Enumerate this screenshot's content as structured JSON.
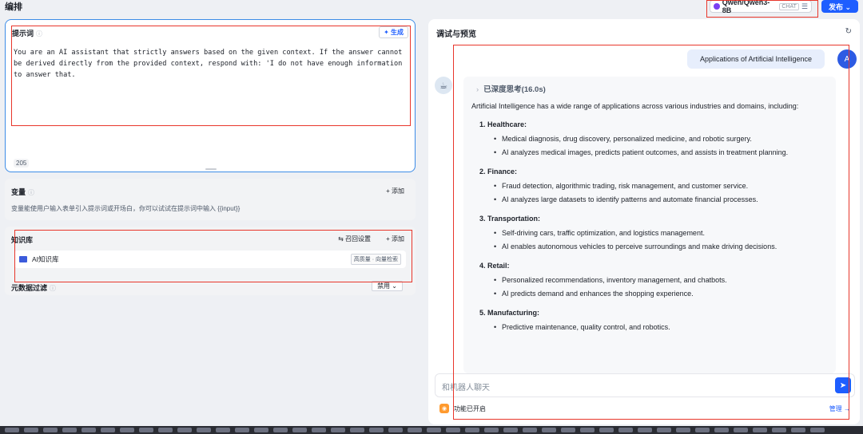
{
  "header": {
    "title": "编排",
    "model_name": "Qwen/Qwen3-8B",
    "model_tag": "CHAT",
    "publish_label": "发布 ⌄"
  },
  "prompt": {
    "title": "提示词",
    "help_icon": "question-circle-icon",
    "generate_label": "✦ 生成",
    "text": "You are an AI assistant that strictly answers based on the given context. If the answer cannot be derived directly from the provided context, respond with: 'I do not have enough information to answer that.",
    "char_count": "205"
  },
  "variables": {
    "title": "变量",
    "add_label": "+ 添加",
    "description": "变量能使用户输入表单引入提示词或开场白，你可以试试在提示词中输入 {{input}}"
  },
  "knowledge": {
    "title": "知识库",
    "recall_label": "⇆ 召回设置",
    "add_label": "+ 添加",
    "item_name": "AI知识库",
    "item_badge": "高质量 · 向量检索"
  },
  "metadata": {
    "title": "元数据过滤",
    "select_value": "禁用 ⌄"
  },
  "preview": {
    "title": "调试与预览",
    "user_message": "Applications of Artificial Intelligence",
    "user_initial": "A",
    "thinking": "已深度思考(16.0s)",
    "intro": "Artificial Intelligence has a wide range of applications across various industries and domains, including:",
    "sections": [
      {
        "heading": "1. Healthcare:",
        "bullets": [
          "Medical diagnosis, drug discovery, personalized medicine, and robotic surgery.",
          "AI analyzes medical images, predicts patient outcomes, and assists in treatment planning."
        ]
      },
      {
        "heading": "2. Finance:",
        "bullets": [
          "Fraud detection, algorithmic trading, risk management, and customer service.",
          "AI analyzes large datasets to identify patterns and automate financial processes."
        ]
      },
      {
        "heading": "3. Transportation:",
        "bullets": [
          "Self-driving cars, traffic optimization, and logistics management.",
          "AI enables autonomous vehicles to perceive surroundings and make driving decisions."
        ]
      },
      {
        "heading": "4. Retail:",
        "bullets": [
          "Personalized recommendations, inventory management, and chatbots.",
          "AI predicts demand and enhances the shopping experience."
        ]
      },
      {
        "heading": "5. Manufacturing:",
        "bullets": [
          "Predictive maintenance, quality control, and robotics."
        ]
      }
    ],
    "input_placeholder": "和机器人聊天",
    "feature_label": "功能已开启",
    "manage_label": "管理 →"
  },
  "colors": {
    "accent": "#1e5eff",
    "highlight": "#e8362b",
    "focus_border": "#3c8ce7"
  }
}
